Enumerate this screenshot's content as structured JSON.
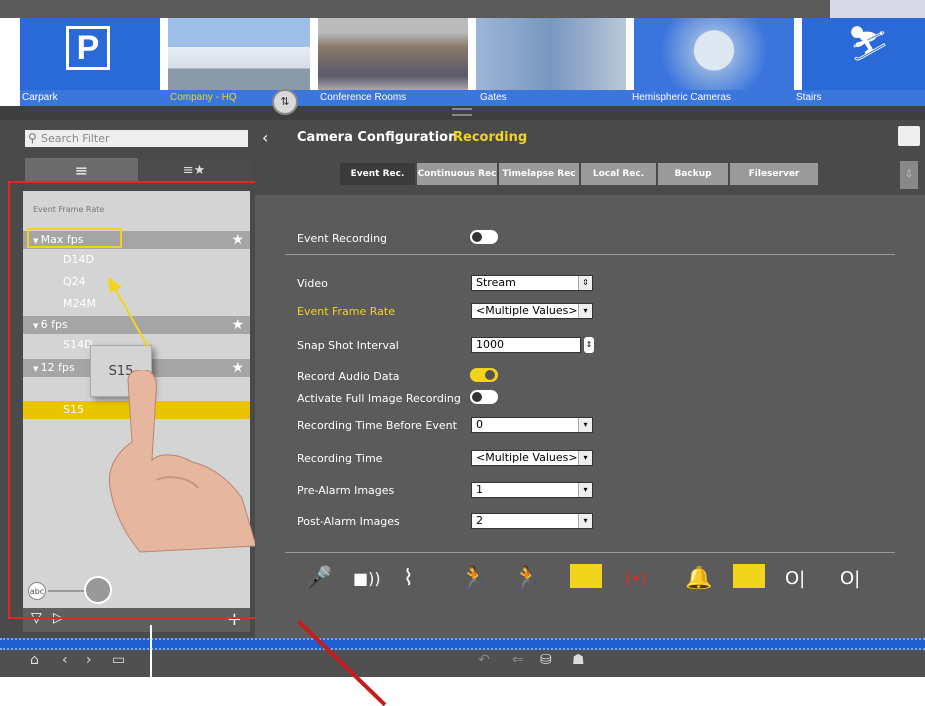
{
  "groups": [
    {
      "label": "Carpark",
      "color": "#2a6ad8",
      "kind": "parking-sign"
    },
    {
      "label": "Company - HQ",
      "color": "#bcd",
      "kind": "photo",
      "highlight": true
    },
    {
      "label": "Conference Rooms",
      "color": "#bcd",
      "kind": "photo"
    },
    {
      "label": "Gates",
      "color": "#bcd",
      "kind": "photo"
    },
    {
      "label": "Hemispheric Cameras",
      "color": "#2a6ad8",
      "kind": "photo"
    },
    {
      "label": "Stairs",
      "color": "#2a6ad8",
      "kind": "stairs-sign"
    }
  ],
  "search": {
    "placeholder": "Search Filter"
  },
  "tree": {
    "title": "Event Frame Rate",
    "groups": [
      {
        "label": "Max fps",
        "cameras": [
          "D14D",
          "Q24",
          "M24M"
        ]
      },
      {
        "label": "6 fps",
        "cameras": [
          "S14D"
        ]
      },
      {
        "label": "12 fps",
        "cameras": []
      }
    ],
    "selected_camera": "S15",
    "drag_chip": "S15"
  },
  "header": {
    "title": "Camera Configuration",
    "subtitle": "Recording"
  },
  "tabs": [
    "Event Rec.",
    "Continuous Rec",
    "Timelapse Rec",
    "Local Rec.",
    "Backup",
    "Fileserver"
  ],
  "form": {
    "event_recording_label": "Event Recording",
    "video_label": "Video",
    "video_value": "Stream",
    "event_frame_rate_label": "Event Frame Rate",
    "event_frame_rate_value": "<Multiple Values>",
    "snap_shot_label": "Snap Shot Interval",
    "snap_shot_value": "1000",
    "record_audio_label": "Record Audio Data",
    "full_image_label": "Activate Full Image Recording",
    "time_before_label": "Recording Time Before Event",
    "time_before_value": "0",
    "recording_time_label": "Recording Time",
    "recording_time_value": "<Multiple Values>",
    "pre_alarm_label": "Pre-Alarm Images",
    "pre_alarm_value": "1",
    "post_alarm_label": "Post-Alarm Images",
    "post_alarm_value": "2"
  },
  "colors": {
    "accent": "#f2d41c",
    "blue": "#1f5fd1",
    "highlight_frame": "#e42626"
  }
}
